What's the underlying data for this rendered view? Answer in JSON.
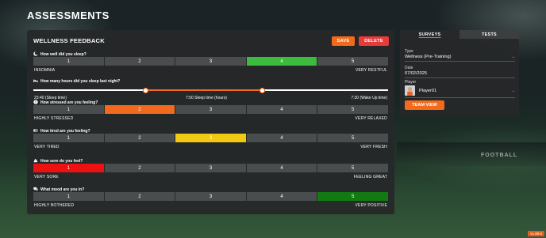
{
  "app_title": "ASSESSMENTS",
  "panel": {
    "title": "WELLNESS FEEDBACK",
    "save_label": "SAVE",
    "delete_label": "DELETE"
  },
  "colors": {
    "orange": "#f26a1b",
    "green": "#3dbb3d",
    "yellow": "#f2c912",
    "red": "#ee1111",
    "dark_green": "#127a12",
    "cell": "#4a4d4e"
  },
  "questions": {
    "sleep": {
      "label": "How well did you sleep?",
      "icon": "moon-icon",
      "options": [
        "1",
        "2",
        "3",
        "4",
        "5"
      ],
      "selected": 4,
      "selected_color": "#3dbb3d",
      "low_label": "INSOMNIA",
      "high_label": "VERY RESTFUL"
    },
    "hours": {
      "label": "How many hours did you sleep last night?",
      "icon": "bed-icon",
      "start_label": "23:40 (Sleep time)",
      "mid_label": "7:50 Sleep time (hours)",
      "end_label": "7:30 (Wake Up time)",
      "start_fraction": 0.317,
      "end_fraction": 0.645
    },
    "stress": {
      "label": "How stressed are you feeling?",
      "icon": "head-icon",
      "options": [
        "1",
        "2",
        "3",
        "4",
        "5"
      ],
      "selected": 2,
      "selected_color": "#f26a1b",
      "low_label": "HIGHLY STRESSED",
      "high_label": "VERY RELAXED"
    },
    "tired": {
      "label": "How tired are you feeling?",
      "icon": "battery-icon",
      "options": [
        "1",
        "2",
        "3",
        "4",
        "5"
      ],
      "selected": 3,
      "selected_color": "#f2c912",
      "low_label": "VERY TIRED",
      "high_label": "VERY FRESH"
    },
    "sore": {
      "label": "How sore do you feel?",
      "icon": "muscle-icon",
      "options": [
        "1",
        "2",
        "3",
        "4",
        "5"
      ],
      "selected": 1,
      "selected_color": "#ee1111",
      "low_label": "VERY SORE",
      "high_label": "FEELING GREAT"
    },
    "mood": {
      "label": "What mood are you in?",
      "icon": "chat-icon",
      "options": [
        "1",
        "2",
        "3",
        "4",
        "5"
      ],
      "selected": 5,
      "selected_color": "#127a12",
      "low_label": "HIGHLY BOTHERED",
      "high_label": "VERY POSITIVE"
    }
  },
  "side": {
    "tabs": [
      "SURVEYS",
      "TESTS"
    ],
    "type_label": "Type",
    "type_value": "Wellness (Pre-Training)",
    "date_label": "Date",
    "date_value": "07/02/2025",
    "player_label": "Player",
    "player_value": "Player01",
    "team_view_label": "TEAM VIEW"
  },
  "background_text": "FOOTBALL",
  "version": "v1.89.6"
}
